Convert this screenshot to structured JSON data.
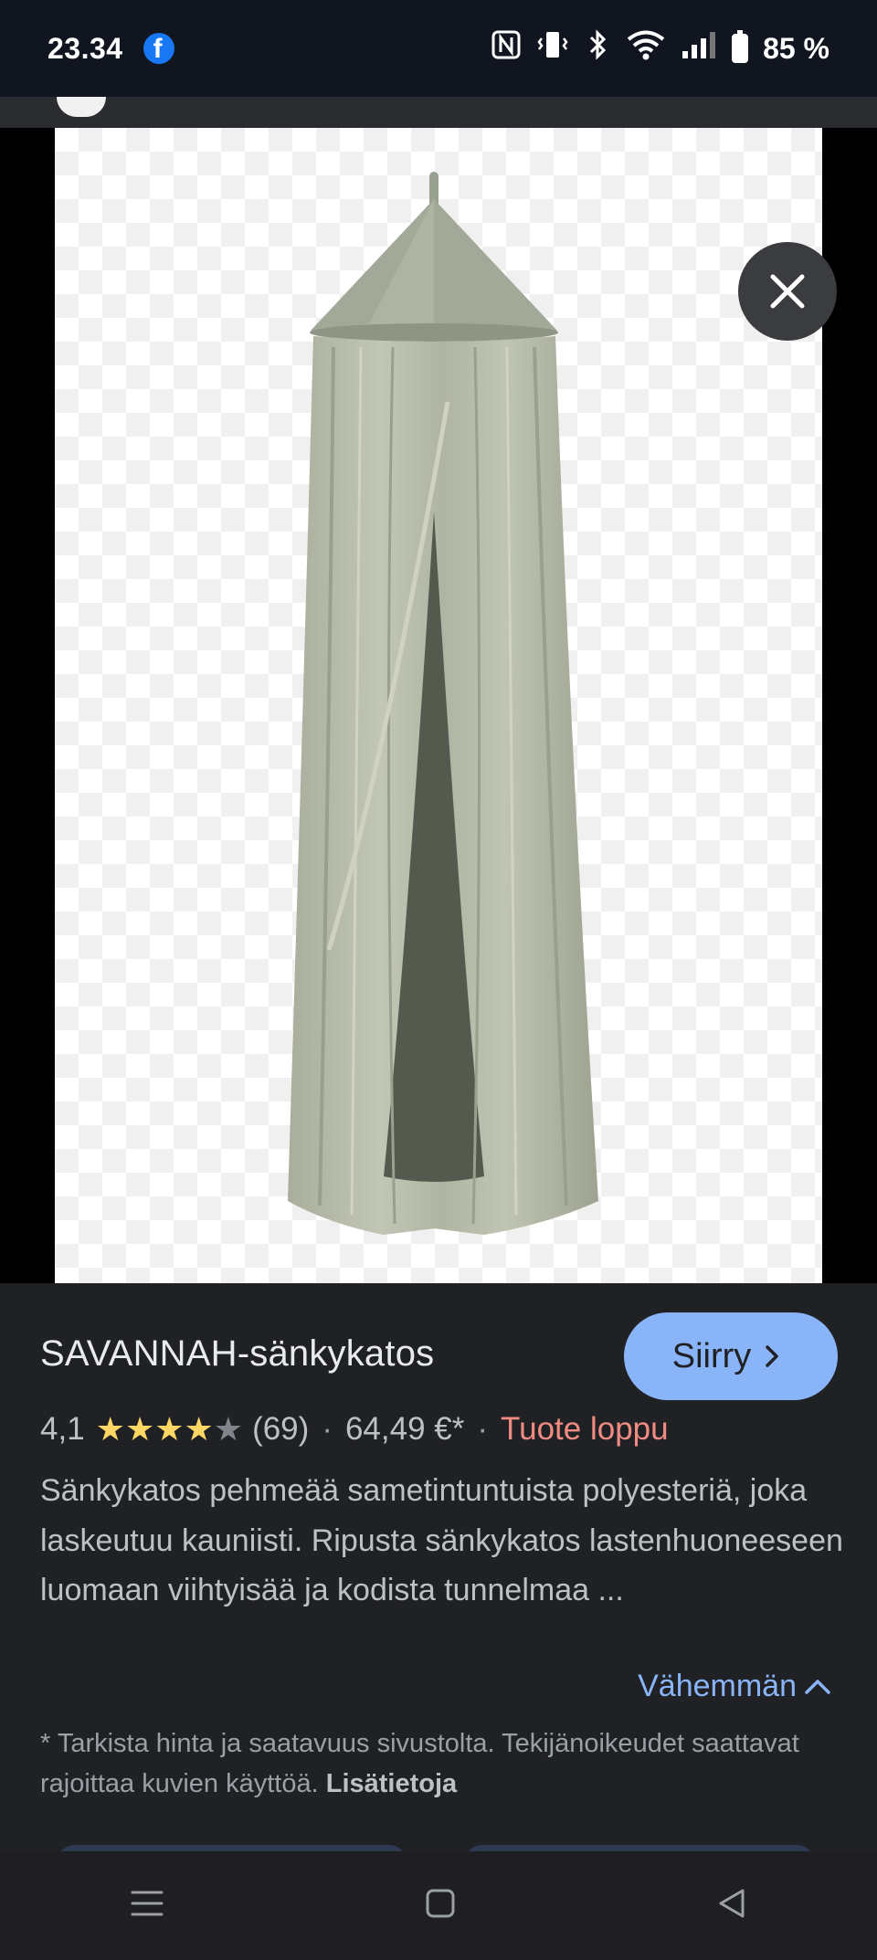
{
  "status_bar": {
    "time": "23.34",
    "battery": "85 %",
    "icons": [
      "facebook-icon",
      "nfc-icon",
      "vibrate-icon",
      "bluetooth-icon",
      "wifi-icon",
      "signal-icon",
      "battery-icon"
    ]
  },
  "viewer": {
    "image_subject": "SAVANNAH-sänkykatos",
    "close_icon": "close-icon",
    "lens_icon": "google-lens-icon"
  },
  "product": {
    "title": "SAVANNAH-sänkykatos",
    "go_button": "Siirry",
    "rating": "4,1",
    "rating_value": 4.1,
    "rating_max": 5,
    "review_count": "(69)",
    "price": "64,49 €*",
    "stock_status": "Tuote loppu",
    "description": "Sänkykatos pehmeää sametintuntuista polyesteriä, joka laskeutuu kauniisti. Ripusta sänkykatos lastenhuoneeseen luomaan viihtyisää ja kodista tunnelmaa ...",
    "less_link": "Vähemmän",
    "disclaimer": "* Tarkista hinta ja saatavuus sivustolta. Tekijänoikeudet saattavat rajoittaa kuvien käyttöä.",
    "more_info_link": "Lisätietoja"
  },
  "colors": {
    "accent": "#8ab4f8",
    "out_of_stock": "#f28b82",
    "star": "#fdd663",
    "panel_bg": "#202124"
  },
  "navigation": {
    "menu_icon": "menu-icon",
    "home_icon": "home-icon",
    "back_icon": "back-icon"
  }
}
